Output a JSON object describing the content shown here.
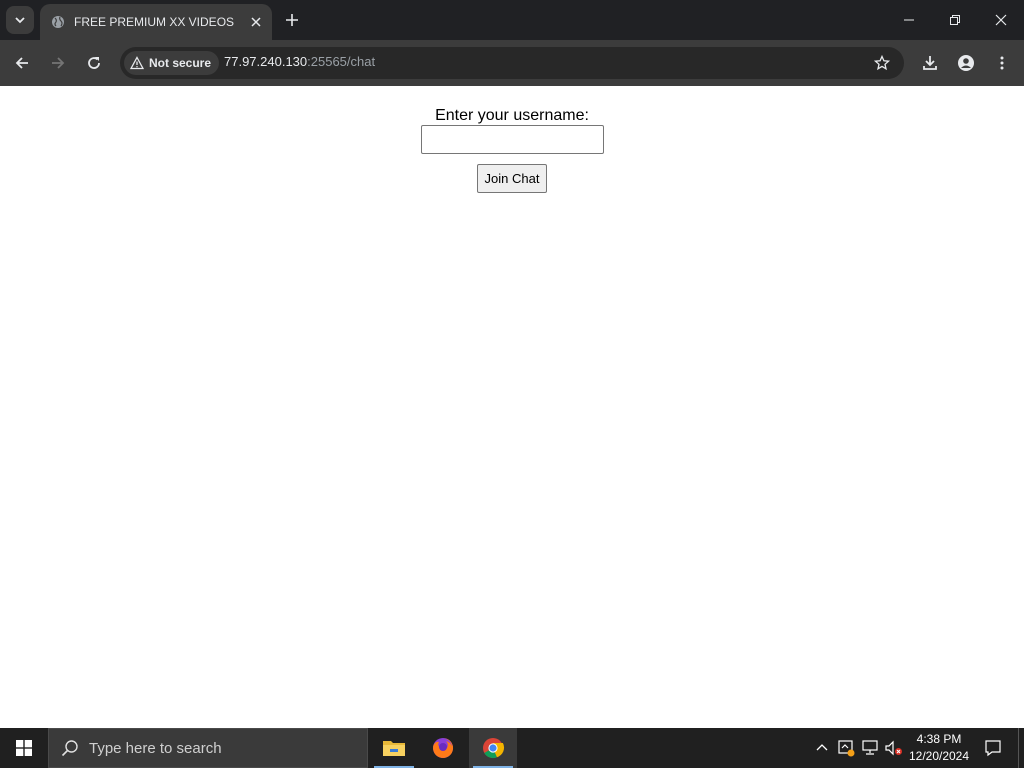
{
  "browser": {
    "tab": {
      "title": "FREE PREMIUM XX VIDEOS",
      "favicon": "globe-icon"
    },
    "address_bar": {
      "security_label": "Not secure",
      "url_host": "77.97.240.130",
      "url_rest": ":25565/chat"
    },
    "colors": {
      "titlebar_bg": "#202124",
      "toolbar_bg": "#3c3c3c",
      "omnibox_bg": "#282828"
    }
  },
  "page": {
    "label": "Enter your username:",
    "input_value": "",
    "button_label": "Join Chat"
  },
  "taskbar": {
    "search_placeholder": "Type here to search",
    "apps": [
      "file-explorer-icon",
      "firefox-icon",
      "chrome-icon"
    ],
    "clock_time": "4:38 PM",
    "clock_date": "12/20/2024"
  }
}
